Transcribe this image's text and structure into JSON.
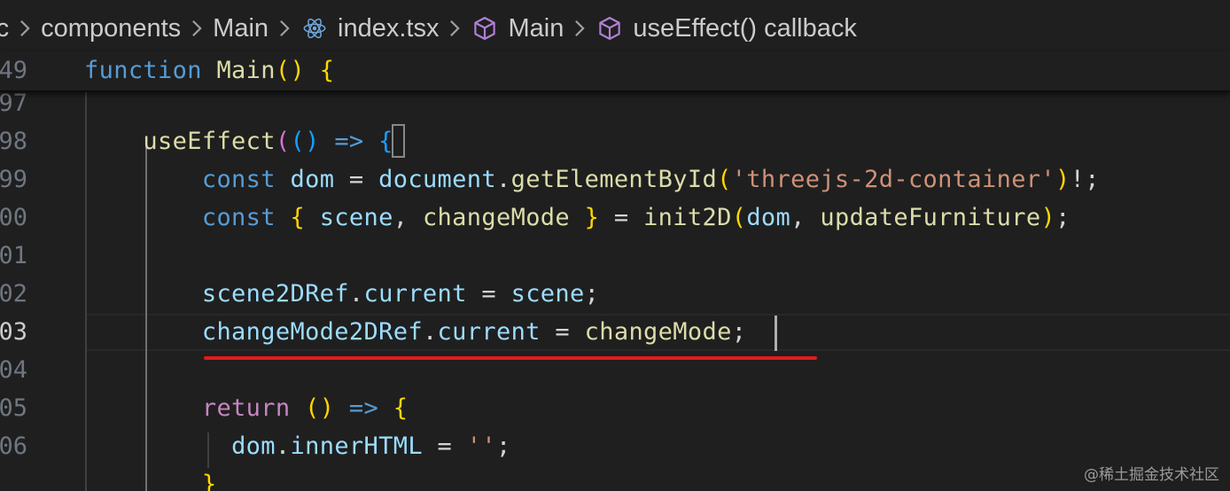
{
  "breadcrumb": {
    "items": [
      {
        "label": "rc",
        "icon": null
      },
      {
        "label": "components",
        "icon": null
      },
      {
        "label": "Main",
        "icon": null
      },
      {
        "label": "index.tsx",
        "icon": "react-icon"
      },
      {
        "label": "Main",
        "icon": "symbol-cube-icon"
      },
      {
        "label": "useEffect() callback",
        "icon": "symbol-cube-icon"
      }
    ],
    "separator_icon": "chevron-right-icon"
  },
  "sticky": {
    "line_number": "49",
    "tokens": [
      {
        "t": "function",
        "c": "kw"
      },
      {
        "t": " ",
        "c": "op"
      },
      {
        "t": "Main",
        "c": "fn"
      },
      {
        "t": "()",
        "c": "p1"
      },
      {
        "t": " ",
        "c": "op"
      },
      {
        "t": "{",
        "c": "p1"
      }
    ]
  },
  "lines": [
    {
      "n": "97",
      "tokens": []
    },
    {
      "n": "98",
      "tokens": [
        {
          "t": "    ",
          "c": "op"
        },
        {
          "t": "useEffect",
          "c": "fn"
        },
        {
          "t": "(",
          "c": "p2"
        },
        {
          "t": "()",
          "c": "p3"
        },
        {
          "t": " ",
          "c": "op"
        },
        {
          "t": "=>",
          "c": "kw"
        },
        {
          "t": " ",
          "c": "op"
        },
        {
          "t": "{",
          "c": "p3"
        }
      ]
    },
    {
      "n": "99",
      "tokens": [
        {
          "t": "        ",
          "c": "op"
        },
        {
          "t": "const",
          "c": "kw"
        },
        {
          "t": " ",
          "c": "op"
        },
        {
          "t": "dom",
          "c": "var"
        },
        {
          "t": " = ",
          "c": "op"
        },
        {
          "t": "document",
          "c": "var"
        },
        {
          "t": ".",
          "c": "op"
        },
        {
          "t": "getElementById",
          "c": "fn"
        },
        {
          "t": "(",
          "c": "p1"
        },
        {
          "t": "'threejs-2d-container'",
          "c": "str"
        },
        {
          "t": ")",
          "c": "p1"
        },
        {
          "t": "!;",
          "c": "op"
        }
      ]
    },
    {
      "n": "00",
      "tokens": [
        {
          "t": "        ",
          "c": "op"
        },
        {
          "t": "const",
          "c": "kw"
        },
        {
          "t": " ",
          "c": "op"
        },
        {
          "t": "{",
          "c": "p1"
        },
        {
          "t": " ",
          "c": "op"
        },
        {
          "t": "scene",
          "c": "var"
        },
        {
          "t": ", ",
          "c": "op"
        },
        {
          "t": "changeMode",
          "c": "fn"
        },
        {
          "t": " ",
          "c": "op"
        },
        {
          "t": "}",
          "c": "p1"
        },
        {
          "t": " = ",
          "c": "op"
        },
        {
          "t": "init2D",
          "c": "fn"
        },
        {
          "t": "(",
          "c": "p1"
        },
        {
          "t": "dom",
          "c": "var"
        },
        {
          "t": ", ",
          "c": "op"
        },
        {
          "t": "updateFurniture",
          "c": "fn"
        },
        {
          "t": ")",
          "c": "p1"
        },
        {
          "t": ";",
          "c": "op"
        }
      ]
    },
    {
      "n": "01",
      "tokens": []
    },
    {
      "n": "02",
      "tokens": [
        {
          "t": "        ",
          "c": "op"
        },
        {
          "t": "scene2DRef",
          "c": "var"
        },
        {
          "t": ".",
          "c": "op"
        },
        {
          "t": "current",
          "c": "var"
        },
        {
          "t": " = ",
          "c": "op"
        },
        {
          "t": "scene",
          "c": "var"
        },
        {
          "t": ";",
          "c": "op"
        }
      ]
    },
    {
      "n": "03",
      "active": true,
      "tokens": [
        {
          "t": "        ",
          "c": "op"
        },
        {
          "t": "changeMode2DRef",
          "c": "var"
        },
        {
          "t": ".",
          "c": "op"
        },
        {
          "t": "current",
          "c": "var"
        },
        {
          "t": " = ",
          "c": "op"
        },
        {
          "t": "changeMode",
          "c": "fn"
        },
        {
          "t": ";",
          "c": "op"
        }
      ]
    },
    {
      "n": "04",
      "tokens": []
    },
    {
      "n": "05",
      "tokens": [
        {
          "t": "        ",
          "c": "op"
        },
        {
          "t": "return",
          "c": "ctl"
        },
        {
          "t": " ",
          "c": "op"
        },
        {
          "t": "()",
          "c": "p1"
        },
        {
          "t": " ",
          "c": "op"
        },
        {
          "t": "=>",
          "c": "kw"
        },
        {
          "t": " ",
          "c": "op"
        },
        {
          "t": "{",
          "c": "p1"
        }
      ]
    },
    {
      "n": "06",
      "tokens": [
        {
          "t": "          ",
          "c": "op"
        },
        {
          "t": "dom",
          "c": "var"
        },
        {
          "t": ".",
          "c": "op"
        },
        {
          "t": "innerHTML",
          "c": "var"
        },
        {
          "t": " = ",
          "c": "op"
        },
        {
          "t": "''",
          "c": "str"
        },
        {
          "t": ";",
          "c": "op"
        }
      ]
    },
    {
      "n": "",
      "tokens": [
        {
          "t": "        ",
          "c": "op"
        },
        {
          "t": "}",
          "c": "p1"
        }
      ]
    }
  ],
  "watermark": "@稀土掘金技术社区",
  "colors": {
    "background": "#1f1f1f",
    "keyword": "#569cd6",
    "function": "#dcdcaa",
    "variable": "#9cdcfe",
    "string": "#ce9178",
    "control": "#c586c0",
    "underline": "#e6191c"
  }
}
